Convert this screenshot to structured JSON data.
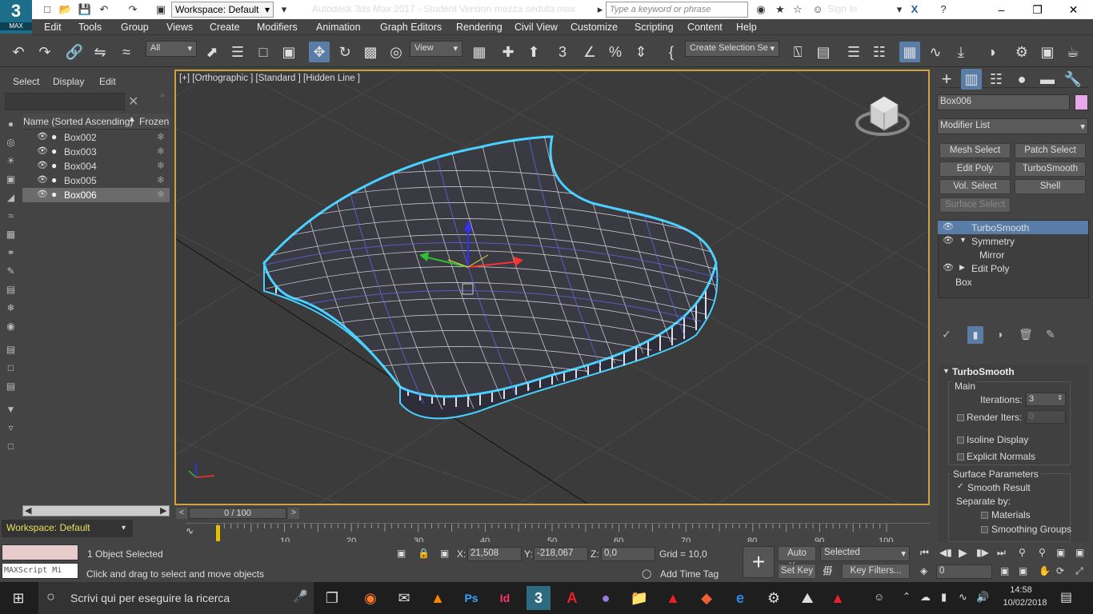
{
  "titlebar": {
    "logo_top": "3",
    "logo_bottom": "MAX",
    "workspace": "Workspace: Default",
    "app_title": "Autodesk 3ds Max 2017 - Student Version",
    "file_name": "mezza seduta.max",
    "search_placeholder": "Type a keyword or phrase",
    "sign_in": "Sign In"
  },
  "menubar": [
    "Edit",
    "Tools",
    "Group",
    "Views",
    "Create",
    "Modifiers",
    "Animation",
    "Graph Editors",
    "Rendering",
    "Civil View",
    "Customize",
    "Scripting",
    "Content",
    "Help"
  ],
  "toolbar": {
    "filter": "All",
    "ref_coord": "View",
    "selection_set": "Create Selection Se"
  },
  "scene_explorer": {
    "menu": [
      "Select",
      "Display",
      "Edit"
    ],
    "col_name": "Name (Sorted Ascending)",
    "col_frozen": "Frozen",
    "rows": [
      "Box002",
      "Box003",
      "Box004",
      "Box005",
      "Box006"
    ],
    "workspace": "Workspace: Default"
  },
  "viewport": {
    "label": "[+] [Orthographic ] [Standard ] [Hidden Line ]"
  },
  "command_panel": {
    "object_name": "Box006",
    "modifier_list": "Modifier List",
    "buttons": [
      "Mesh Select",
      "Patch Select",
      "Edit Poly",
      "TurboSmooth",
      "Vol. Select",
      "Shell",
      "Surface Select"
    ],
    "stack": [
      "TurboSmooth",
      "Symmetry",
      "Mirror",
      "Edit Poly",
      "Box"
    ],
    "rollout_title": "TurboSmooth",
    "main_group": "Main",
    "iterations_label": "Iterations:",
    "iterations_value": "3",
    "render_iters_label": "Render Iters:",
    "render_iters_value": "0",
    "isoline_display": "Isoline Display",
    "explicit_normals": "Explicit Normals",
    "surface_params": "Surface Parameters",
    "smooth_result": "Smooth Result",
    "separate_by": "Separate by:",
    "materials": "Materials",
    "smoothing_groups": "Smoothing Groups"
  },
  "timeline": {
    "frame": "0 / 100",
    "ticks": [
      "10",
      "20",
      "30",
      "40",
      "50",
      "60",
      "70",
      "80",
      "90",
      "100"
    ]
  },
  "status": {
    "maxscript": "MAXScript Mi",
    "selected_count": "1 Object Selected",
    "prompt": "Click and drag to select and move objects",
    "x_label": "X:",
    "x_value": "21,508",
    "y_label": "Y:",
    "y_value": "-218,067",
    "z_label": "Z:",
    "z_value": "0,0",
    "grid": "Grid = 10,0",
    "add_time_tag": "Add Time Tag",
    "auto_key": "Auto Key",
    "set_key": "Set Key",
    "selected_mode": "Selected",
    "key_filters": "Key Filters...",
    "frame_field": "0"
  },
  "taskbar": {
    "search_text": "Scrivi qui per eseguire la ricerca",
    "time": "14:58",
    "date": "10/02/2018"
  },
  "colors": {
    "viewport_border": "#cfa23d",
    "selection_blue": "#5a7da8",
    "wire_highlight": "#48d0ff",
    "object_color": "#e8a8e8"
  }
}
